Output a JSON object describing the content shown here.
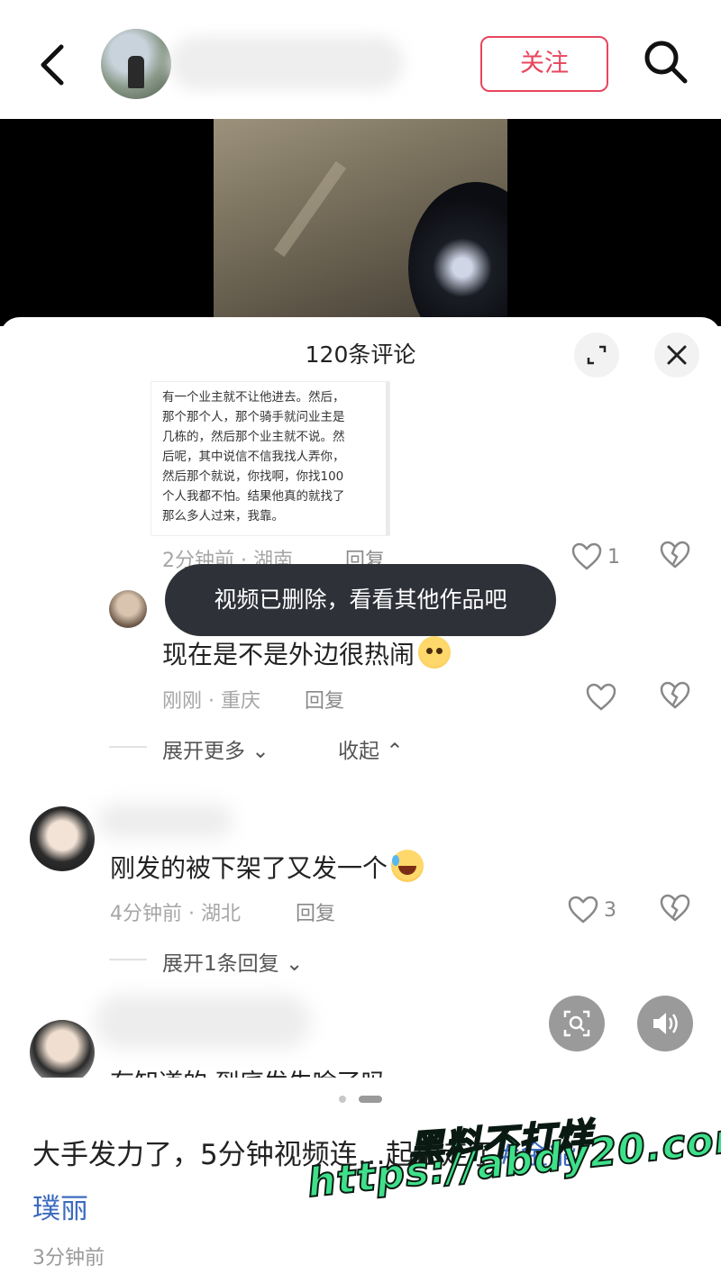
{
  "header": {
    "follow_label": "关注"
  },
  "comments_sheet": {
    "title": "120条评论",
    "quote_text": "有一个业主就不让他进去。然后，\n那个那个人，那个骑手就问业主是\n几栋的，然后那个业主就不说。然\n后呢，其中说信不信我找人弄你，\n然后那个就说，你找啊，你找100\n个人我都不怕。结果他真的就找了\n那么多人过来，我靠。",
    "quote_meta": "2分钟前 · 湖南",
    "quote_reply": "回复",
    "quote_likes": "1",
    "toast": "视频已删除，看看其他作品吧",
    "reply1": {
      "text": "现在是不是外边很热闹",
      "meta": "刚刚 · 重庆",
      "reply": "回复"
    },
    "expand_more": "展开更多",
    "collapse": "收起",
    "comment2": {
      "text": "刚发的被下架了又发一个",
      "meta": "4分钟前 · 湖北",
      "reply": "回复",
      "likes": "3",
      "expand_replies": "展开1条回复"
    },
    "comment3": {
      "text": "有知道的 到底发生啥了吗"
    }
  },
  "post": {
    "text": "大手发力了，5分钟视频连",
    "text_hidden_tail": "…起拍走了",
    "hashtag_a": "#金能",
    "hashtag_b": "璞丽",
    "time": "3分钟前"
  },
  "watermark": {
    "line1": "黑料不打烊",
    "line2": "https://abdy20.com"
  },
  "colors": {
    "accent": "#e8455d",
    "hashtag": "#3d6bbf",
    "toast_bg": "#2f3139",
    "watermark": "#3ee08a"
  }
}
